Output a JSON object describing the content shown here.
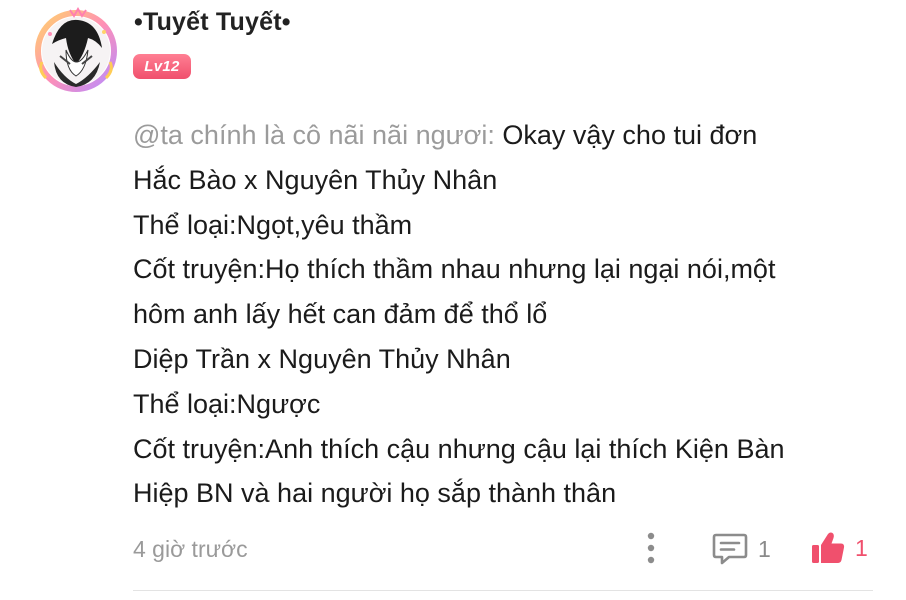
{
  "comment": {
    "author": {
      "name": "•Tuyết Tuyết•",
      "level": "Lv12"
    },
    "body": {
      "mention": "@ta chính là cô nãi nãi ngươi:",
      "first_line_rest": " Okay vậy cho tui đơn",
      "lines": [
        "Hắc Bào x Nguyên Thủy Nhân",
        "Thể loại:Ngọt,yêu thầm",
        "Cốt truyện:Họ thích thầm nhau nhưng lại ngại nói,một",
        "hôm anh lấy hết can đảm để thổ lổ",
        "Diệp Trần x Nguyên Thủy Nhân",
        "Thể loại:Ngược",
        "Cốt truyện:Anh thích cậu nhưng cậu lại thích Kiện Bàn",
        "Hiệp BN và hai người họ sắp thành thân"
      ]
    },
    "timestamp": "4 giờ trước",
    "reply_count": "1",
    "like_count": "1",
    "icons": {
      "avatar": "avatar-image",
      "more": "more-vertical-icon",
      "reply": "comment-icon",
      "like": "thumbs-up-icon"
    },
    "colors": {
      "accent": "#f0506d",
      "mention": "#9b9b9b",
      "meta": "#9a9a9a"
    }
  }
}
